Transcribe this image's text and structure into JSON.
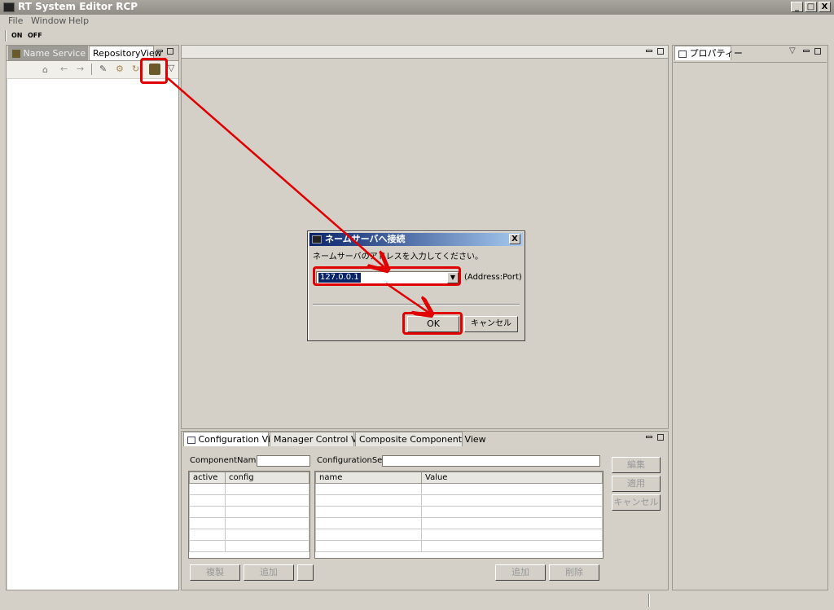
{
  "window": {
    "title": "RT System Editor RCP",
    "min_label": "_",
    "max_label": "□",
    "close_label": "X"
  },
  "menu": [
    "File",
    "Window",
    "Help"
  ],
  "toolbar": {
    "on_label": "ON",
    "off_label": "OFF"
  },
  "left_panel": {
    "tab_nameservice": "Name Service ...",
    "tab_repository": "RepositoryView"
  },
  "right_panel": {
    "tab_properties": "プロパティー"
  },
  "dialog": {
    "title": "ネームサーバへ接続",
    "message": "ネームサーバのアドレスを入力してください。",
    "address_value": "127.0.0.1",
    "address_hint": "(Address:Port)",
    "ok_label": "OK",
    "cancel_label": "キャンセル",
    "close_label": "X"
  },
  "bottom_panel": {
    "tabs": [
      "Configuration View",
      "Manager Control View",
      "Composite Component View"
    ],
    "component_name_label": "ComponentName:",
    "configuration_set_label": "ConfigurationSet:",
    "left_table_headers": [
      "active",
      "config"
    ],
    "right_table_headers": [
      "name",
      "Value"
    ],
    "edit_button": "編集",
    "apply_button": "適用",
    "cancel_button": "キャンセル",
    "copy_button": "複製",
    "add_button_left": "追加",
    "add_button_right": "追加",
    "delete_button": "削除"
  },
  "colors": {
    "highlight": "#e00000",
    "dialog_title_start": "#0a246a"
  }
}
